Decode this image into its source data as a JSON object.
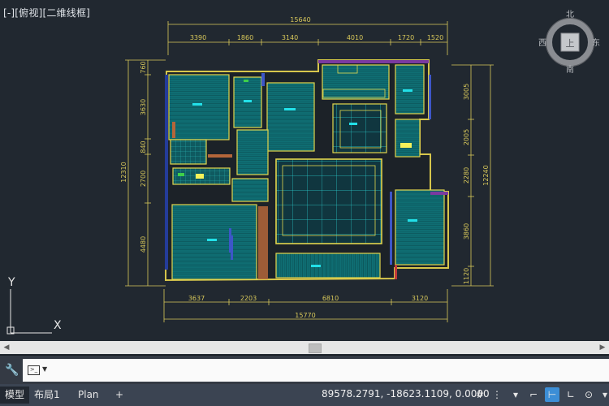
{
  "viewport": {
    "view_label": "[-][俯视][二维线框]",
    "viewcube": {
      "north": "北",
      "south": "南",
      "east": "东",
      "west": "西",
      "face": "上"
    },
    "ucs": {
      "y": "Y",
      "x": "X"
    }
  },
  "drawing": {
    "top_dims": {
      "total": "15640",
      "segments": [
        "3390",
        "1860",
        "3140",
        "4010",
        "1720",
        "1520"
      ]
    },
    "bottom_dims": {
      "total": "15770",
      "segments": [
        "3637",
        "2203",
        "6810",
        "3120"
      ]
    },
    "left_dims": {
      "total": "12310",
      "segments": [
        "760",
        "3630",
        "840",
        "2700",
        "4480"
      ]
    },
    "right_dims": {
      "total": "12240",
      "segments": [
        "3005",
        "2005",
        "2280",
        "3860",
        "1120"
      ]
    }
  },
  "command_line": {
    "value": ""
  },
  "status": {
    "tabs": [
      "模型",
      "布局1",
      "Plan"
    ],
    "add_tab": "+",
    "coordinates": "89578.2791, -18623.1109, 0.0000"
  }
}
